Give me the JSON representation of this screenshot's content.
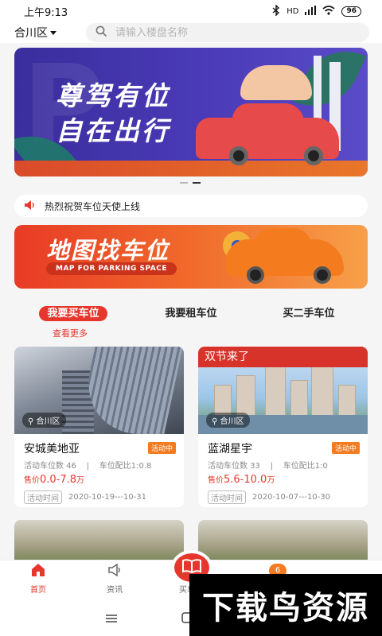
{
  "status": {
    "time": "上午9:13",
    "battery": "96",
    "network": "HD"
  },
  "header": {
    "district": "合川区",
    "search_placeholder": "请输入楼盘名称"
  },
  "hero": {
    "line1": "尊驾有位",
    "line2": "自在出行"
  },
  "notice": {
    "text": "热烈祝贺车位天使上线"
  },
  "map_banner": {
    "title": "地图找车位",
    "subtitle": "MAP FOR PARKING SPACE"
  },
  "tabs": [
    {
      "label": "我要买车位",
      "active": true
    },
    {
      "label": "我要租车位",
      "active": false
    },
    {
      "label": "买二手车位",
      "active": false
    }
  ],
  "more_label": "查看更多",
  "cards": [
    {
      "name": "安城美地亚",
      "ribbon": "",
      "location": "合川区",
      "badge": "活动中",
      "count_label": "活动车位数 46",
      "ratio_label": "车位配比1:0.8",
      "price_prefix": "售价",
      "price": "0.0-7.8",
      "price_unit": "万",
      "time_label": "活动时间",
      "time_range": "2020-10-19---10-31"
    },
    {
      "name": "蓝湖星宇",
      "ribbon": "双节来了",
      "location": "合川区",
      "badge": "活动中",
      "count_label": "活动车位数 33",
      "ratio_label": "车位配比1:0",
      "price_prefix": "售价",
      "price": "5.6-10.0",
      "price_unit": "万",
      "time_label": "活动时间",
      "time_range": "2020-10-07---10-30"
    }
  ],
  "bottom_nav": [
    {
      "label": "首页",
      "icon": "home-icon",
      "active": true
    },
    {
      "label": "资讯",
      "icon": "megaphone-icon",
      "active": false
    },
    {
      "label": "买车位",
      "icon": "book-icon",
      "active": false
    },
    {
      "label": "",
      "icon": "message-icon",
      "active": false
    },
    {
      "label": "",
      "icon": "user-icon",
      "active": false
    }
  ],
  "notification_count": "6",
  "watermark": "下载鸟资源",
  "colors": {
    "accent": "#e7362d",
    "badge": "#f47b20"
  }
}
